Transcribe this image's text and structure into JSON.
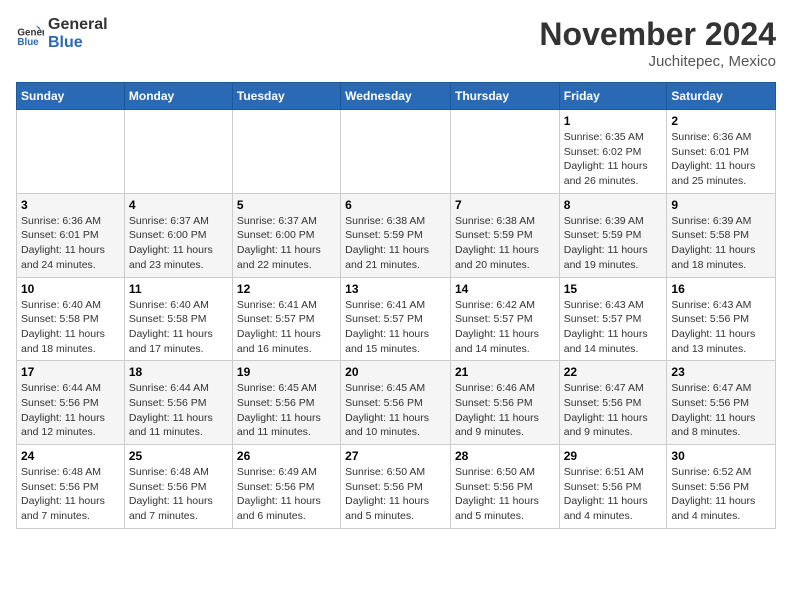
{
  "logo": {
    "line1": "General",
    "line2": "Blue"
  },
  "title": "November 2024",
  "location": "Juchitepec, Mexico",
  "days_of_week": [
    "Sunday",
    "Monday",
    "Tuesday",
    "Wednesday",
    "Thursday",
    "Friday",
    "Saturday"
  ],
  "weeks": [
    [
      {
        "day": "",
        "info": ""
      },
      {
        "day": "",
        "info": ""
      },
      {
        "day": "",
        "info": ""
      },
      {
        "day": "",
        "info": ""
      },
      {
        "day": "",
        "info": ""
      },
      {
        "day": "1",
        "info": "Sunrise: 6:35 AM\nSunset: 6:02 PM\nDaylight: 11 hours and 26 minutes."
      },
      {
        "day": "2",
        "info": "Sunrise: 6:36 AM\nSunset: 6:01 PM\nDaylight: 11 hours and 25 minutes."
      }
    ],
    [
      {
        "day": "3",
        "info": "Sunrise: 6:36 AM\nSunset: 6:01 PM\nDaylight: 11 hours and 24 minutes."
      },
      {
        "day": "4",
        "info": "Sunrise: 6:37 AM\nSunset: 6:00 PM\nDaylight: 11 hours and 23 minutes."
      },
      {
        "day": "5",
        "info": "Sunrise: 6:37 AM\nSunset: 6:00 PM\nDaylight: 11 hours and 22 minutes."
      },
      {
        "day": "6",
        "info": "Sunrise: 6:38 AM\nSunset: 5:59 PM\nDaylight: 11 hours and 21 minutes."
      },
      {
        "day": "7",
        "info": "Sunrise: 6:38 AM\nSunset: 5:59 PM\nDaylight: 11 hours and 20 minutes."
      },
      {
        "day": "8",
        "info": "Sunrise: 6:39 AM\nSunset: 5:59 PM\nDaylight: 11 hours and 19 minutes."
      },
      {
        "day": "9",
        "info": "Sunrise: 6:39 AM\nSunset: 5:58 PM\nDaylight: 11 hours and 18 minutes."
      }
    ],
    [
      {
        "day": "10",
        "info": "Sunrise: 6:40 AM\nSunset: 5:58 PM\nDaylight: 11 hours and 18 minutes."
      },
      {
        "day": "11",
        "info": "Sunrise: 6:40 AM\nSunset: 5:58 PM\nDaylight: 11 hours and 17 minutes."
      },
      {
        "day": "12",
        "info": "Sunrise: 6:41 AM\nSunset: 5:57 PM\nDaylight: 11 hours and 16 minutes."
      },
      {
        "day": "13",
        "info": "Sunrise: 6:41 AM\nSunset: 5:57 PM\nDaylight: 11 hours and 15 minutes."
      },
      {
        "day": "14",
        "info": "Sunrise: 6:42 AM\nSunset: 5:57 PM\nDaylight: 11 hours and 14 minutes."
      },
      {
        "day": "15",
        "info": "Sunrise: 6:43 AM\nSunset: 5:57 PM\nDaylight: 11 hours and 14 minutes."
      },
      {
        "day": "16",
        "info": "Sunrise: 6:43 AM\nSunset: 5:56 PM\nDaylight: 11 hours and 13 minutes."
      }
    ],
    [
      {
        "day": "17",
        "info": "Sunrise: 6:44 AM\nSunset: 5:56 PM\nDaylight: 11 hours and 12 minutes."
      },
      {
        "day": "18",
        "info": "Sunrise: 6:44 AM\nSunset: 5:56 PM\nDaylight: 11 hours and 11 minutes."
      },
      {
        "day": "19",
        "info": "Sunrise: 6:45 AM\nSunset: 5:56 PM\nDaylight: 11 hours and 11 minutes."
      },
      {
        "day": "20",
        "info": "Sunrise: 6:45 AM\nSunset: 5:56 PM\nDaylight: 11 hours and 10 minutes."
      },
      {
        "day": "21",
        "info": "Sunrise: 6:46 AM\nSunset: 5:56 PM\nDaylight: 11 hours and 9 minutes."
      },
      {
        "day": "22",
        "info": "Sunrise: 6:47 AM\nSunset: 5:56 PM\nDaylight: 11 hours and 9 minutes."
      },
      {
        "day": "23",
        "info": "Sunrise: 6:47 AM\nSunset: 5:56 PM\nDaylight: 11 hours and 8 minutes."
      }
    ],
    [
      {
        "day": "24",
        "info": "Sunrise: 6:48 AM\nSunset: 5:56 PM\nDaylight: 11 hours and 7 minutes."
      },
      {
        "day": "25",
        "info": "Sunrise: 6:48 AM\nSunset: 5:56 PM\nDaylight: 11 hours and 7 minutes."
      },
      {
        "day": "26",
        "info": "Sunrise: 6:49 AM\nSunset: 5:56 PM\nDaylight: 11 hours and 6 minutes."
      },
      {
        "day": "27",
        "info": "Sunrise: 6:50 AM\nSunset: 5:56 PM\nDaylight: 11 hours and 5 minutes."
      },
      {
        "day": "28",
        "info": "Sunrise: 6:50 AM\nSunset: 5:56 PM\nDaylight: 11 hours and 5 minutes."
      },
      {
        "day": "29",
        "info": "Sunrise: 6:51 AM\nSunset: 5:56 PM\nDaylight: 11 hours and 4 minutes."
      },
      {
        "day": "30",
        "info": "Sunrise: 6:52 AM\nSunset: 5:56 PM\nDaylight: 11 hours and 4 minutes."
      }
    ]
  ]
}
